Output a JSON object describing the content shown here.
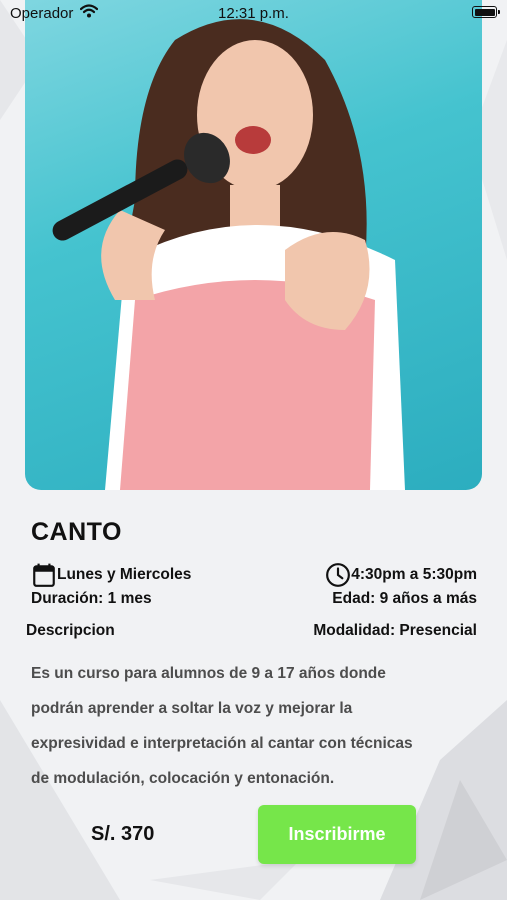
{
  "status_bar": {
    "carrier": "Operador",
    "time": "12:31 p.m.",
    "icons": [
      "wifi-icon",
      "battery-icon"
    ]
  },
  "hero": {
    "image_subject": "girl singing into a microphone against a teal background",
    "background_color": "#45c3cf"
  },
  "course": {
    "title": "CANTO",
    "days": "Lunes y Miercoles",
    "time": "4:30pm a 5:30pm",
    "duration": "Duración: 1 mes",
    "age": "Edad: 9 años a más",
    "description_label": "Descripcion",
    "modality": "Modalidad: Presencial",
    "description": [
      "Es un curso para alumnos de 9 a 17 años donde",
      "podrán aprender a soltar la voz y mejorar la",
      "expresividad e interpretación al cantar con técnicas",
      "de modulación, colocación y entonación."
    ],
    "price": "S/. 370",
    "enroll_label": "Inscribirme"
  },
  "colors": {
    "accent_button": "#76e64a",
    "text": "#111111",
    "description_text": "#4d4d4d"
  }
}
